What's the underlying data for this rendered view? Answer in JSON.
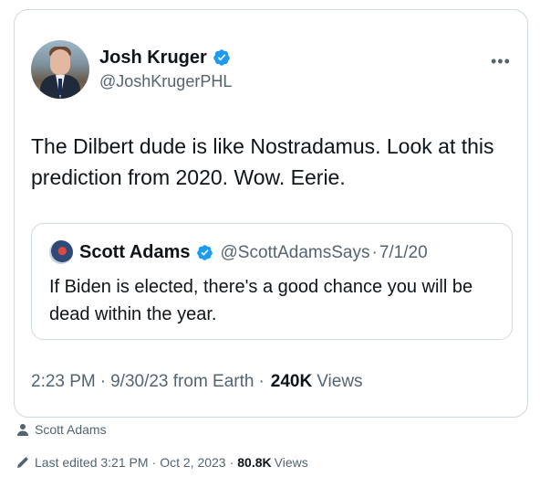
{
  "tweet": {
    "author_name": "Josh Kruger",
    "author_handle": "@JoshKrugerPHL",
    "more_label": "•••",
    "text": "The Dilbert dude is like Nostradamus. Look at this prediction from 2020. Wow. Eerie.",
    "quote": {
      "author_name": "Scott Adams",
      "author_handle": "@ScottAdamsSays",
      "separator": "·",
      "date": "7/1/20",
      "text": "If Biden is elected, there's a good chance you will be dead within the year."
    },
    "meta": {
      "time": "2:23 PM",
      "separator": "·",
      "date_source": "9/30/23 from Earth",
      "views_count": "240K",
      "views_label": "Views"
    }
  },
  "caption": {
    "author": "Scott Adams",
    "edited_label": "Last edited 3:21 PM",
    "separator": "·",
    "edited_date": "Oct 2, 2023",
    "views_count": "80.8K",
    "views_label": "Views"
  },
  "colors": {
    "verified": "#1d9bf0",
    "text": "#0f1419",
    "secondary": "#536471",
    "border": "#cfd9de"
  },
  "icons": {
    "verified": "verified-badge-icon",
    "more": "more-options-icon",
    "author": "person-icon",
    "edit": "pencil-icon"
  }
}
